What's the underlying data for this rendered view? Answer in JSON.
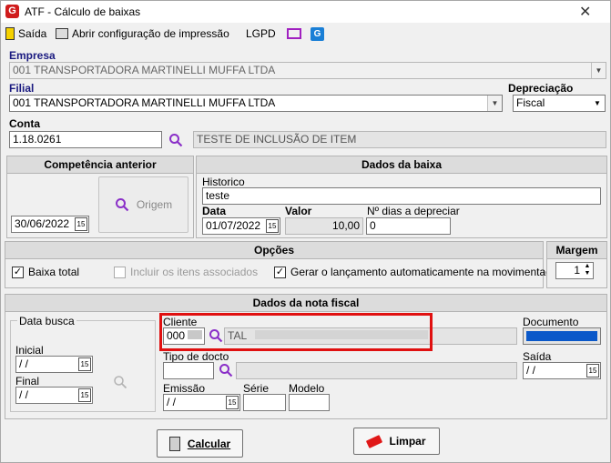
{
  "window": {
    "title": "ATF - Cálculo de baixas",
    "logo": "G"
  },
  "toolbar": {
    "saida": "Saída",
    "print": "Abrir configuração de impressão",
    "lgpd": "LGPD"
  },
  "empresa": {
    "label": "Empresa",
    "value": "001 TRANSPORTADORA MARTINELLI MUFFA LTDA"
  },
  "filial": {
    "label": "Filial",
    "value": "001 TRANSPORTADORA MARTINELLI MUFFA LTDA"
  },
  "depreciacao": {
    "label": "Depreciação",
    "value": "Fiscal"
  },
  "conta": {
    "label": "Conta",
    "value": "1.18.0261",
    "descricao": "TESTE DE INCLUSÃO DE ITEM"
  },
  "competencia": {
    "title": "Competência anterior",
    "data": "30/06/2022",
    "origem": "Origem"
  },
  "dados_baixa": {
    "title": "Dados da baixa",
    "historico_label": "Historico",
    "historico": "teste",
    "data_label": "Data",
    "data": "01/07/2022",
    "valor_label": "Valor",
    "valor": "10,00",
    "dias_label": "Nº dias a depreciar",
    "dias": "0"
  },
  "opcoes": {
    "title": "Opções",
    "baixa_total": "Baixa total",
    "incluir": "Incluir os itens associados",
    "gerar": "Gerar o lançamento automaticamente na movimentação"
  },
  "margem": {
    "title": "Margem",
    "value": "1"
  },
  "nota": {
    "title": "Dados da nota fiscal",
    "data_busca": "Data busca",
    "inicial_label": "Inicial",
    "inicial": " / /",
    "final_label": "Final",
    "final": " / /",
    "cliente_label": "Cliente",
    "cliente_code": "000",
    "cliente_name": "TAL",
    "documento_label": "Documento",
    "tipo_label": "Tipo de docto",
    "saida_label": "Saída",
    "saida": " / /",
    "emissao_label": "Emissão",
    "emissao": " / /",
    "serie_label": "Série",
    "modelo_label": "Modelo"
  },
  "buttons": {
    "calcular": "Calcular",
    "limpar": "Limpar"
  },
  "colors": {
    "highlight": "#e01010",
    "accent": "#0a58c9"
  }
}
